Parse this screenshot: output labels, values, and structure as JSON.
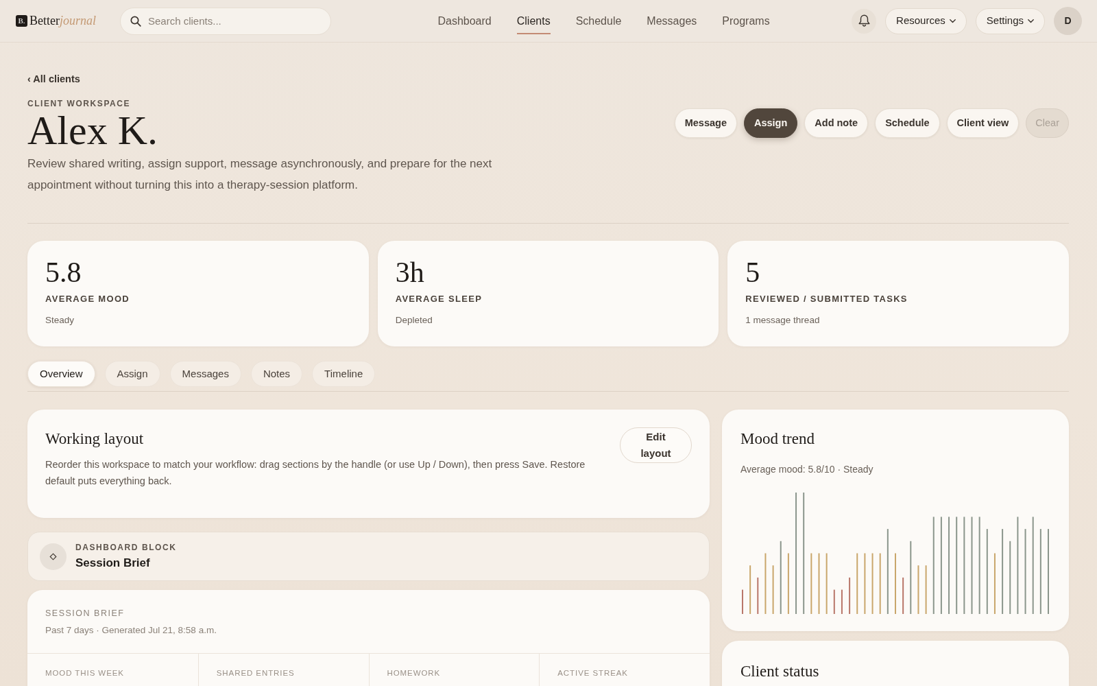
{
  "navbar": {
    "logo": {
      "mark": "B.",
      "wordmark": "Better",
      "accent": "journal"
    },
    "search": {
      "placeholder": "Search clients..."
    },
    "links": [
      {
        "label": "Dashboard",
        "selected": false
      },
      {
        "label": "Clients",
        "selected": true
      },
      {
        "label": "Schedule",
        "selected": false
      },
      {
        "label": "Messages",
        "selected": false
      },
      {
        "label": "Programs",
        "selected": false
      }
    ],
    "menus": [
      "Resources",
      "Settings"
    ],
    "avatar": "D"
  },
  "header": {
    "back_link": "‹ All clients",
    "eyebrow": "CLIENT WORKSPACE",
    "title": "Alex K.",
    "description": "Review shared writing, assign support, message asynchronously, and prepare for the next appointment without turning this into a therapy-session platform.",
    "actions": [
      {
        "label": "Message",
        "kind": "secondary",
        "disabled": false
      },
      {
        "label": "Assign",
        "kind": "primary",
        "disabled": false
      },
      {
        "label": "Add note",
        "kind": "secondary",
        "disabled": false
      },
      {
        "label": "Schedule",
        "kind": "secondary",
        "disabled": false
      },
      {
        "label": "Client view",
        "kind": "secondary",
        "disabled": false
      },
      {
        "label": "Clear",
        "kind": "secondary",
        "disabled": true
      }
    ]
  },
  "stats": [
    {
      "value": "5.8",
      "label": "AVERAGE MOOD",
      "note": "Steady"
    },
    {
      "value": "3h",
      "label": "AVERAGE SLEEP",
      "note": "Depleted"
    },
    {
      "value": "5",
      "label": "REVIEWED / SUBMITTED TASKS",
      "note": "1 message thread"
    }
  ],
  "tabs": [
    {
      "label": "Overview",
      "selected": true
    },
    {
      "label": "Assign",
      "selected": false
    },
    {
      "label": "Messages",
      "selected": false
    },
    {
      "label": "Notes",
      "selected": false
    },
    {
      "label": "Timeline",
      "selected": false
    }
  ],
  "working_layout": {
    "title": "Working layout",
    "description": "Reorder this workspace to match your workflow: drag sections by the handle (or use Up / Down), then press Save. Restore default puts everything back.",
    "button": "Edit layout"
  },
  "dashboard_block": {
    "eyebrow": "DASHBOARD BLOCK",
    "title": "Session Brief"
  },
  "session_brief": {
    "eyebrow": "SESSION BRIEF",
    "meta": "Past 7 days · Generated Jul 21, 8:58 a.m.",
    "metric_labels": [
      "MOOD THIS WEEK",
      "SHARED ENTRIES",
      "HOMEWORK",
      "ACTIVE STREAK"
    ]
  },
  "mood_trend": {
    "title": "Mood trend",
    "summary": "Average mood: 5.8/10 · Steady"
  },
  "client_status": {
    "title": "Client status"
  }
}
